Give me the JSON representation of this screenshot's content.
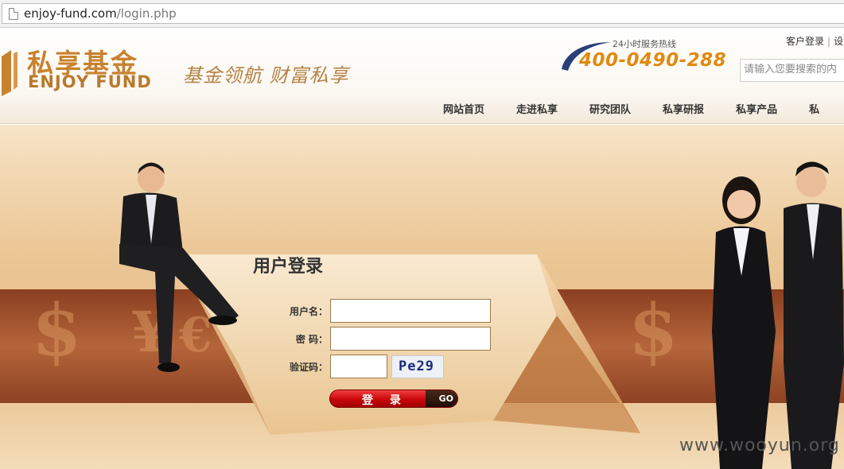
{
  "browser": {
    "url_host": "enjoy-fund.com",
    "url_path": "/login.php"
  },
  "header": {
    "logo_cn": "私享基金",
    "logo_en": "ENJOY FUND",
    "slogan": "基金领航  财富私享",
    "hotline_label": "24小时服务热线",
    "hotline_number": "400-0490-288",
    "top_links": [
      "客户登录",
      "设"
    ],
    "search_placeholder": "请输入您要搜索的内",
    "nav": [
      "网站首页",
      "走进私享",
      "研究团队",
      "私享研报",
      "私享产品",
      "私"
    ]
  },
  "login": {
    "title": "用户登录",
    "username_label": "用户名：",
    "password_label": "密 码：",
    "captcha_label": "验证码：",
    "captcha_text": "Pe29",
    "login_button": "登 录",
    "go_label": "GO"
  },
  "watermark": "www.wooyun.org",
  "colors": {
    "brand": "#c8822e",
    "hotline": "#e08a10",
    "button": "#c9060a",
    "banner_band": "#b5653a"
  }
}
